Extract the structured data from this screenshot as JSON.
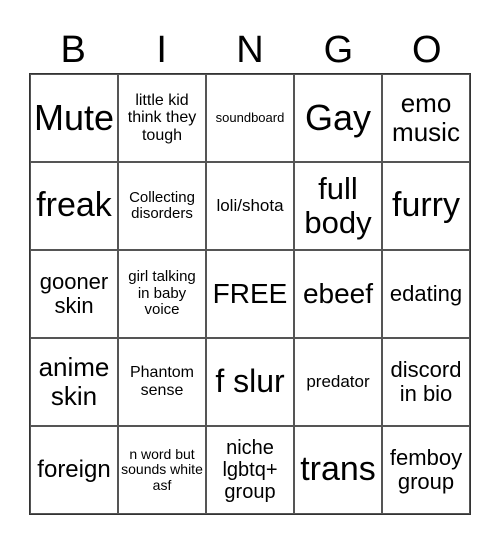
{
  "header": {
    "letters": [
      "B",
      "I",
      "N",
      "G",
      "O"
    ]
  },
  "cells": [
    {
      "text": "Mute"
    },
    {
      "text": "little kid think they tough"
    },
    {
      "text": "soundboard"
    },
    {
      "text": "Gay"
    },
    {
      "text": "emo music"
    },
    {
      "text": "freak"
    },
    {
      "text": "Collecting disorders"
    },
    {
      "text": "loli/shota"
    },
    {
      "text": "full body"
    },
    {
      "text": "furry"
    },
    {
      "text": "gooner skin"
    },
    {
      "text": "girl talking in baby voice"
    },
    {
      "text": "FREE"
    },
    {
      "text": "ebeef"
    },
    {
      "text": "edating"
    },
    {
      "text": "anime skin"
    },
    {
      "text": "Phantom sense"
    },
    {
      "text": "f slur"
    },
    {
      "text": "predator"
    },
    {
      "text": "discord in bio"
    },
    {
      "text": "foreign"
    },
    {
      "text": "n word but sounds white asf"
    },
    {
      "text": "niche lgbtq+ group"
    },
    {
      "text": "trans"
    },
    {
      "text": "femboy group"
    }
  ]
}
